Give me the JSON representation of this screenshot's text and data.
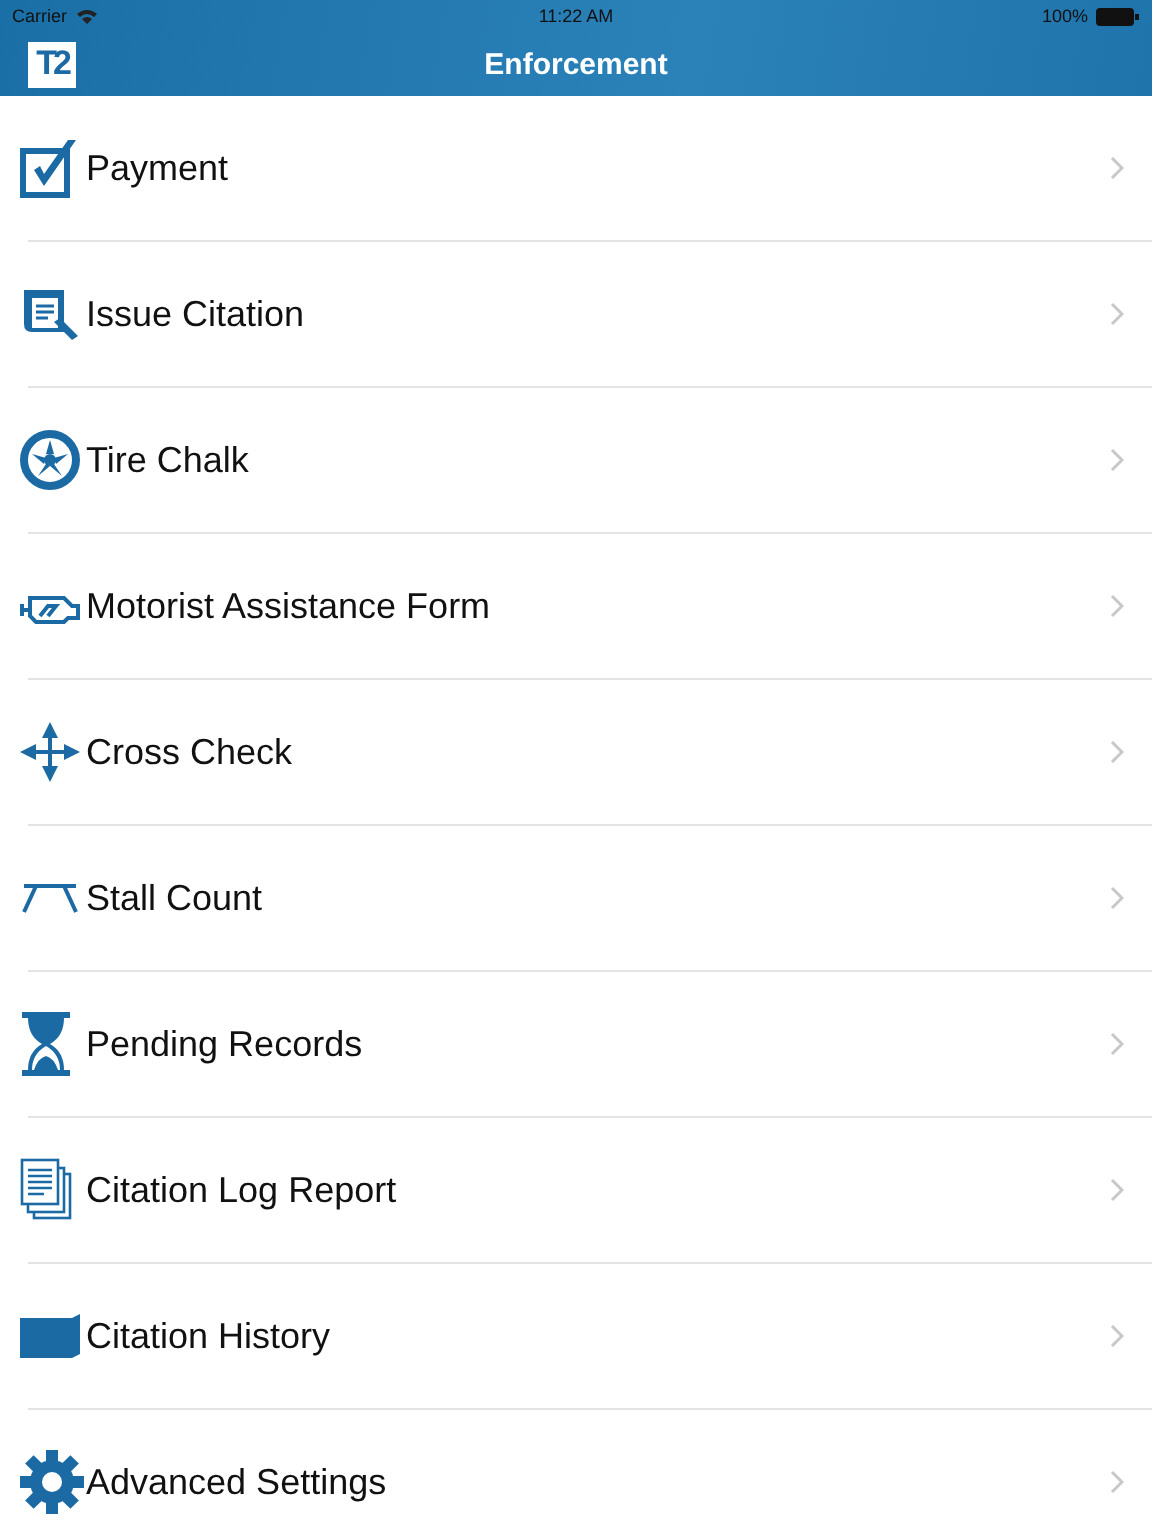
{
  "status_bar": {
    "carrier": "Carrier",
    "time": "11:22 AM",
    "battery": "100%"
  },
  "nav_bar": {
    "logo": "T2",
    "title": "Enforcement"
  },
  "menu": [
    {
      "label": "Payment",
      "kind": "checkbox"
    },
    {
      "label": "Issue Citation",
      "kind": "scroll"
    },
    {
      "label": "Tire Chalk",
      "kind": "tire"
    },
    {
      "label": "Motorist Assistance Form",
      "kind": "engine"
    },
    {
      "label": "Cross Check",
      "kind": "cross"
    },
    {
      "label": "Stall Count",
      "kind": "stall"
    },
    {
      "label": "Pending Records",
      "kind": "hourglass"
    },
    {
      "label": "Citation Log Report",
      "kind": "documents"
    },
    {
      "label": "Citation History",
      "kind": "folder"
    },
    {
      "label": "Advanced Settings",
      "kind": "gear"
    }
  ]
}
